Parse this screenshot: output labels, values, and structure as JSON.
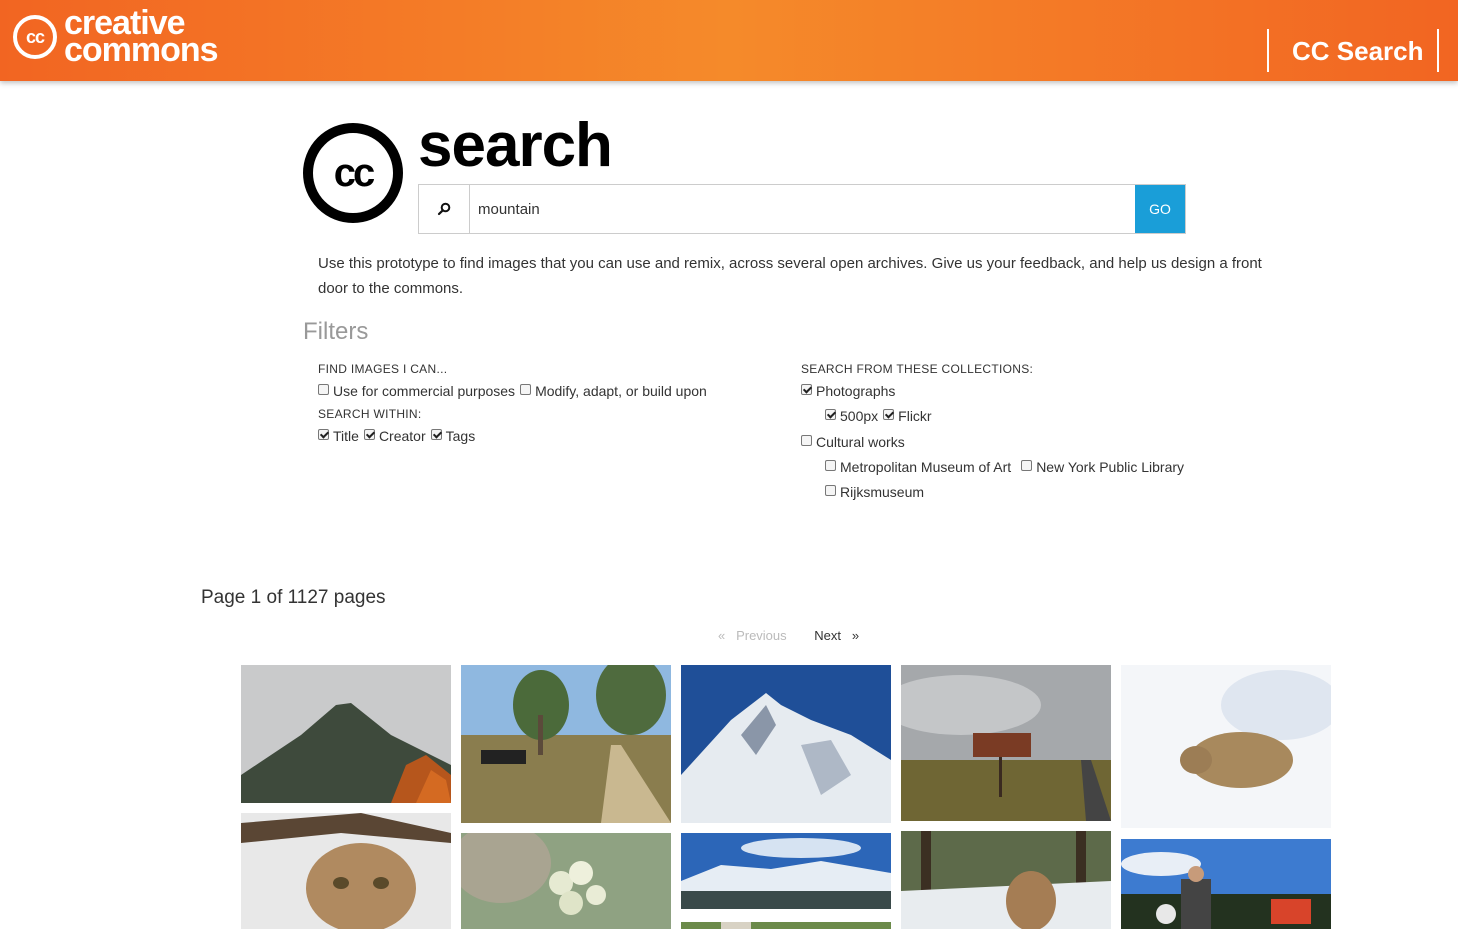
{
  "header": {
    "brand_mark": "cc",
    "brand_line1": "creative",
    "brand_line2": "commons",
    "nav_link": "CC Search",
    "brand_color": "#f26522"
  },
  "search": {
    "logo_text": "cc",
    "title": "search",
    "query": "mountain",
    "icon": "search-icon",
    "go_label": "GO",
    "go_color": "#1a9ed8"
  },
  "intro": "Use this prototype to find images that you can use and remix, across several open archives. Give us your feedback, and help us design a front door to the commons.",
  "filters": {
    "title": "Filters",
    "find_label": "FIND IMAGES I CAN...",
    "find_options": [
      {
        "label": "Use for commercial purposes",
        "checked": false
      },
      {
        "label": "Modify, adapt, or build upon",
        "checked": false
      }
    ],
    "within_label": "SEARCH WITHIN:",
    "within_options": [
      {
        "label": "Title",
        "checked": true
      },
      {
        "label": "Creator",
        "checked": true
      },
      {
        "label": "Tags",
        "checked": true
      }
    ],
    "collections_label": "SEARCH FROM THESE COLLECTIONS:",
    "photographs": {
      "label": "Photographs",
      "checked": true
    },
    "photo_sources": [
      {
        "label": "500px",
        "checked": true
      },
      {
        "label": "Flickr",
        "checked": true
      }
    ],
    "cultural": {
      "label": "Cultural works",
      "checked": false
    },
    "cultural_sources": [
      {
        "label": "Metropolitan Museum of Art",
        "checked": false
      },
      {
        "label": "New York Public Library",
        "checked": false
      },
      {
        "label": "Rijksmuseum",
        "checked": false
      }
    ]
  },
  "pagination": {
    "info": "Page 1 of 1127 pages",
    "prev": "«   Previous",
    "next": "Next   »"
  },
  "results": [
    {
      "name": "mountain-peak-photo"
    },
    {
      "name": "dirt-road-motorcycles-photo"
    },
    {
      "name": "snowy-mountain-photo"
    },
    {
      "name": "road-sign-field-photo"
    },
    {
      "name": "hare-in-snow-photo"
    },
    {
      "name": "cougar-photo"
    },
    {
      "name": "white-flower-buds-photo"
    },
    {
      "name": "snowy-range-sky-photo"
    },
    {
      "name": "green-leaves-photo"
    },
    {
      "name": "cougar-forest-photo"
    },
    {
      "name": "motorcyclist-mountain-photo"
    }
  ]
}
